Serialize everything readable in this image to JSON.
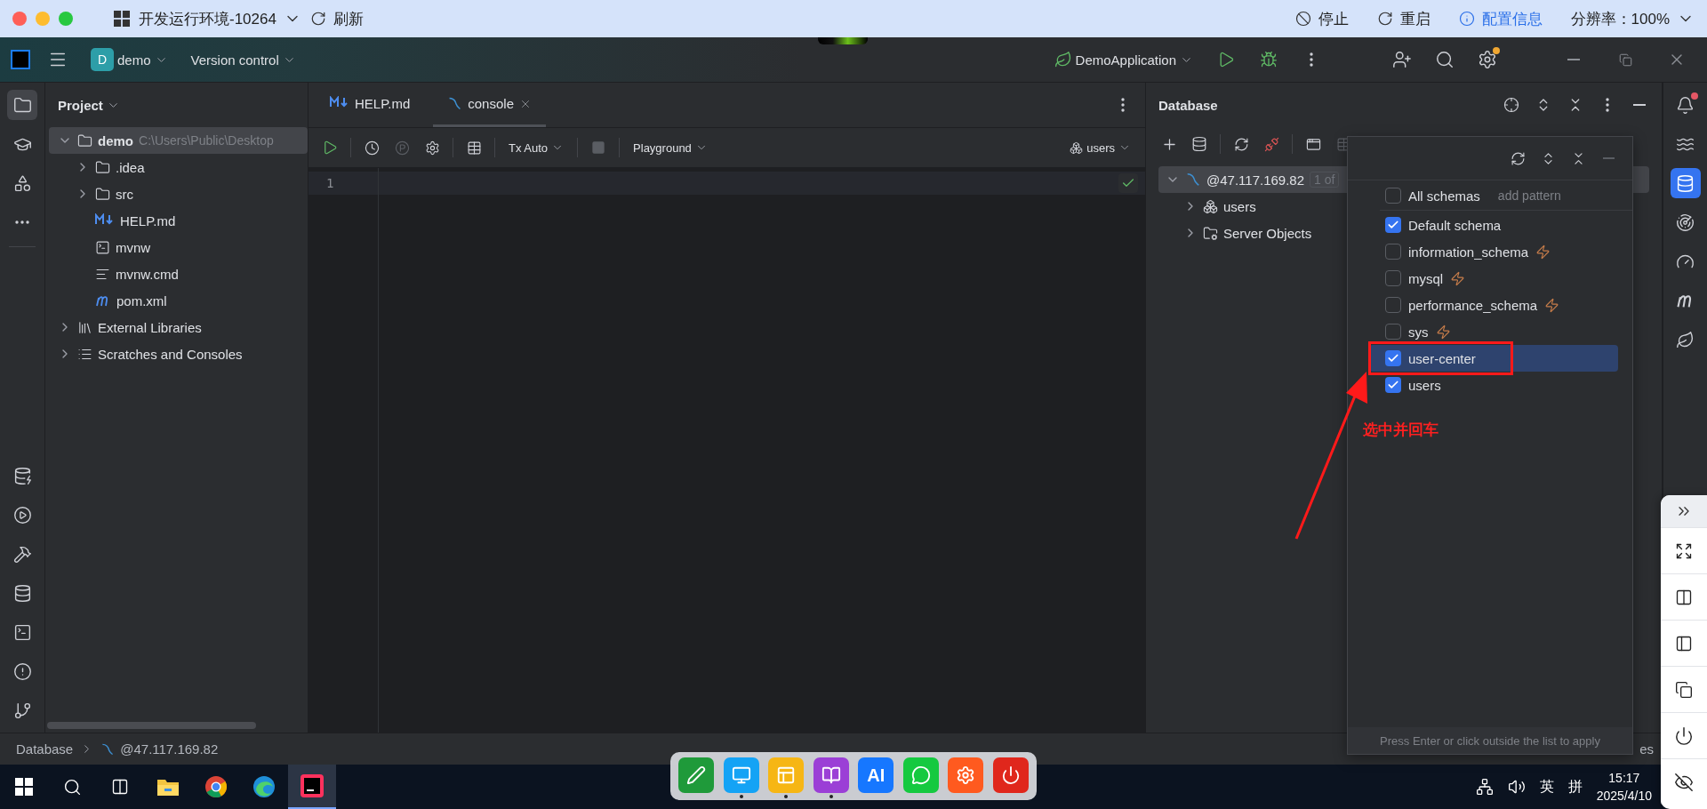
{
  "top_bar": {
    "title": "开发运行环境-10264",
    "refresh": "刷新",
    "actions": [
      {
        "kind": "stop",
        "label": "停止"
      },
      {
        "kind": "restart",
        "label": "重启"
      },
      {
        "kind": "info",
        "label": "配置信息"
      }
    ],
    "resolution": "分辨率：100%"
  },
  "header": {
    "project_badge": "D",
    "project": "demo",
    "vcs": "Version control",
    "run_config": "DemoApplication",
    "settings_badge": true
  },
  "left_tools": [
    {
      "selected": true
    },
    {
      "selected": false
    },
    {
      "selected": false
    },
    {
      "selected": false
    }
  ],
  "left_tools_bottom": [
    {
      "selected": false
    },
    {
      "selected": false
    },
    {
      "selected": false
    },
    {
      "selected": false
    },
    {
      "selected": false
    },
    {
      "selected": false
    },
    {
      "selected": false
    }
  ],
  "project": {
    "title": "Project",
    "tree": [
      {
        "kind": "module",
        "label": "demo",
        "path": "C:\\Users\\Public\\Desktop",
        "expanded": true,
        "selected": true,
        "children": [
          {
            "kind": "folder",
            "label": ".idea",
            "expanded": false,
            "selected": false
          },
          {
            "kind": "folder",
            "label": "src",
            "expanded": false,
            "selected": false
          },
          {
            "kind": "markdown",
            "label": "HELP.md",
            "selected": false
          },
          {
            "kind": "script",
            "label": "mvnw",
            "selected": false
          },
          {
            "kind": "text",
            "label": "mvnw.cmd",
            "selected": false
          },
          {
            "kind": "maven",
            "label": "pom.xml",
            "selected": false
          }
        ]
      },
      {
        "kind": "libraries",
        "label": "External Libraries",
        "expanded": false,
        "selected": false
      },
      {
        "kind": "scratches",
        "label": "Scratches and Consoles",
        "expanded": false,
        "selected": false
      }
    ]
  },
  "editor": {
    "tabs": [
      {
        "kind": "markdown",
        "label": "HELP.md",
        "selected": false
      },
      {
        "kind": "console",
        "label": "console",
        "selected": true
      }
    ],
    "tx": "Tx Auto",
    "mode": "Playground",
    "schema": "users",
    "lines": [
      "1"
    ],
    "valid": true
  },
  "database": {
    "title": "Database",
    "tree": [
      {
        "kind": "server",
        "label": "@47.117.169.82",
        "badge": "1 of",
        "expanded": true,
        "selected": true,
        "children": [
          {
            "kind": "schema",
            "label": "users",
            "expanded": false,
            "selected": false
          },
          {
            "kind": "server-objects",
            "label": "Server Objects",
            "expanded": false,
            "selected": false
          }
        ]
      }
    ]
  },
  "schema_popup": {
    "items": [
      {
        "label": "All schemas",
        "hint": "add pattern",
        "checked": false,
        "selected": false,
        "system": false
      },
      {
        "label": "Default schema",
        "checked": true,
        "selected": false,
        "system": false
      },
      {
        "label": "information_schema",
        "checked": false,
        "selected": false,
        "system": true
      },
      {
        "label": "mysql",
        "checked": false,
        "selected": false,
        "system": true
      },
      {
        "label": "performance_schema",
        "checked": false,
        "selected": false,
        "system": true
      },
      {
        "label": "sys",
        "checked": false,
        "selected": false,
        "system": true
      },
      {
        "label": "user-center",
        "checked": true,
        "selected": true,
        "system": false
      },
      {
        "label": "users",
        "checked": true,
        "selected": false,
        "system": false
      }
    ],
    "footer": "Press Enter or click outside the list to apply"
  },
  "annotation": {
    "note": "选中并回车"
  },
  "right_tools": [
    {
      "selected": false,
      "badge": true
    },
    {
      "selected": false
    },
    {
      "selected": true
    },
    {
      "selected": false
    },
    {
      "selected": false
    },
    {
      "selected": false
    },
    {
      "selected": false
    }
  ],
  "status_bar": {
    "crumbs": [
      {
        "kind": "label",
        "label": "Database"
      },
      {
        "kind": "server",
        "label": "@47.117.169.82"
      }
    ],
    "right": "es"
  },
  "taskbar": {
    "apps": [
      {
        "selected": false
      },
      {
        "selected": false
      },
      {
        "selected": false
      },
      {
        "selected": true
      }
    ],
    "lang": "英",
    "ime": "拼",
    "time": "15:17",
    "date": "2025/4/10"
  },
  "dock": [
    {
      "color": "#1f9a3a"
    },
    {
      "color": "#14a3f5",
      "running": true
    },
    {
      "color": "#f6b614",
      "running": true
    },
    {
      "color": "#9b3fd6",
      "running": true
    },
    {
      "color": "#1677ff",
      "label": "AI"
    },
    {
      "color": "#15c940"
    },
    {
      "color": "#ff5a1f"
    },
    {
      "color": "#e0271c"
    }
  ]
}
